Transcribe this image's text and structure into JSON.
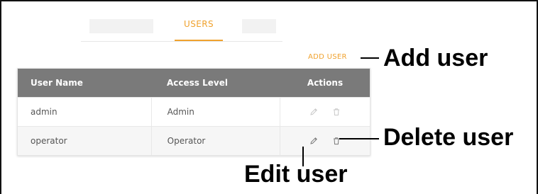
{
  "tabs": {
    "active_label": "USERS"
  },
  "toolbar": {
    "add_user_label": "ADD USER"
  },
  "table": {
    "headers": {
      "user_name": "User Name",
      "access_level": "Access Level",
      "actions": "Actions"
    },
    "rows": [
      {
        "user_name": "admin",
        "access_level": "Admin",
        "actions_enabled": false
      },
      {
        "user_name": "operator",
        "access_level": "Operator",
        "actions_enabled": true
      }
    ]
  },
  "annotations": {
    "add_user": "Add user",
    "delete_user": "Delete user",
    "edit_user": "Edit user"
  },
  "icons": {
    "edit": "pencil-icon",
    "delete": "trash-icon"
  },
  "colors": {
    "accent": "#f0a22e",
    "header_bg": "#7a7a7a",
    "icon_disabled": "#c8c8c8",
    "icon_enabled": "#7a7a7a"
  }
}
